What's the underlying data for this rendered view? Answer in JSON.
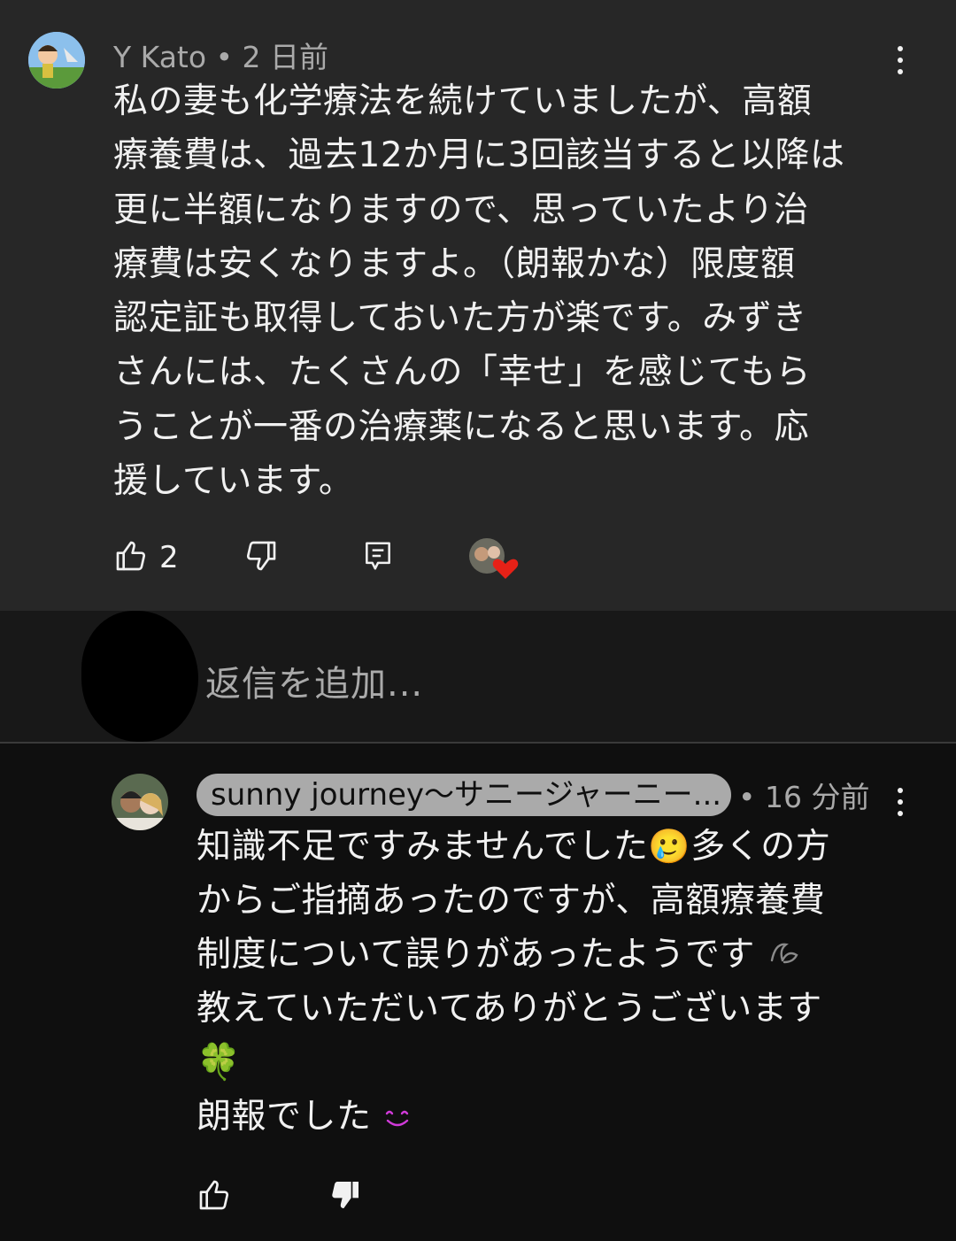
{
  "comment": {
    "author": "Y Kato",
    "separator": "•",
    "time": "2 日前",
    "text": "私の妻も化学療法を続けていましたが、高額\n療養費は、過去12か月に3回該当すると以降は\n更に半額になりますので、思っていたより治\n療費は安くなりますよ。（朗報かな）限度額\n認定証も取得しておいた方が楽です。みずき\nさんには、たくさんの「幸せ」を感じてもら\nうことが一番の治療薬になると思います。応\n援しています。",
    "like_count": "2",
    "icons": [
      "thumbs-up-icon",
      "thumbs-down-icon",
      "reply-icon",
      "creator-heart-icon",
      "more-vert-icon"
    ]
  },
  "reply_input": {
    "placeholder": "返信を追加..."
  },
  "reply": {
    "author": "sunny journey〜サニージャーニー...",
    "separator": "•",
    "time": "16 分前",
    "line1": "知識不足ですみませんでした",
    "emoji_tear": "🥲",
    "line1b": "多くの方",
    "line2": "からご指摘あったのですが、高額療養費",
    "line3": "制度について誤りがあったようです",
    "line4": "教えていただいてありがとうございます",
    "emoji_clover": "🍀",
    "line5": "朗報でした",
    "emoji_smile": "◡̈",
    "icons": [
      "thumbs-up-icon",
      "thumbs-down-filled-icon",
      "more-vert-icon"
    ]
  },
  "colors": {
    "comment_bg": "#272727",
    "page_bg": "#0f0f0f",
    "text": "#f1f1f1",
    "meta": "#aaaaaa",
    "heart": "#e62117"
  }
}
